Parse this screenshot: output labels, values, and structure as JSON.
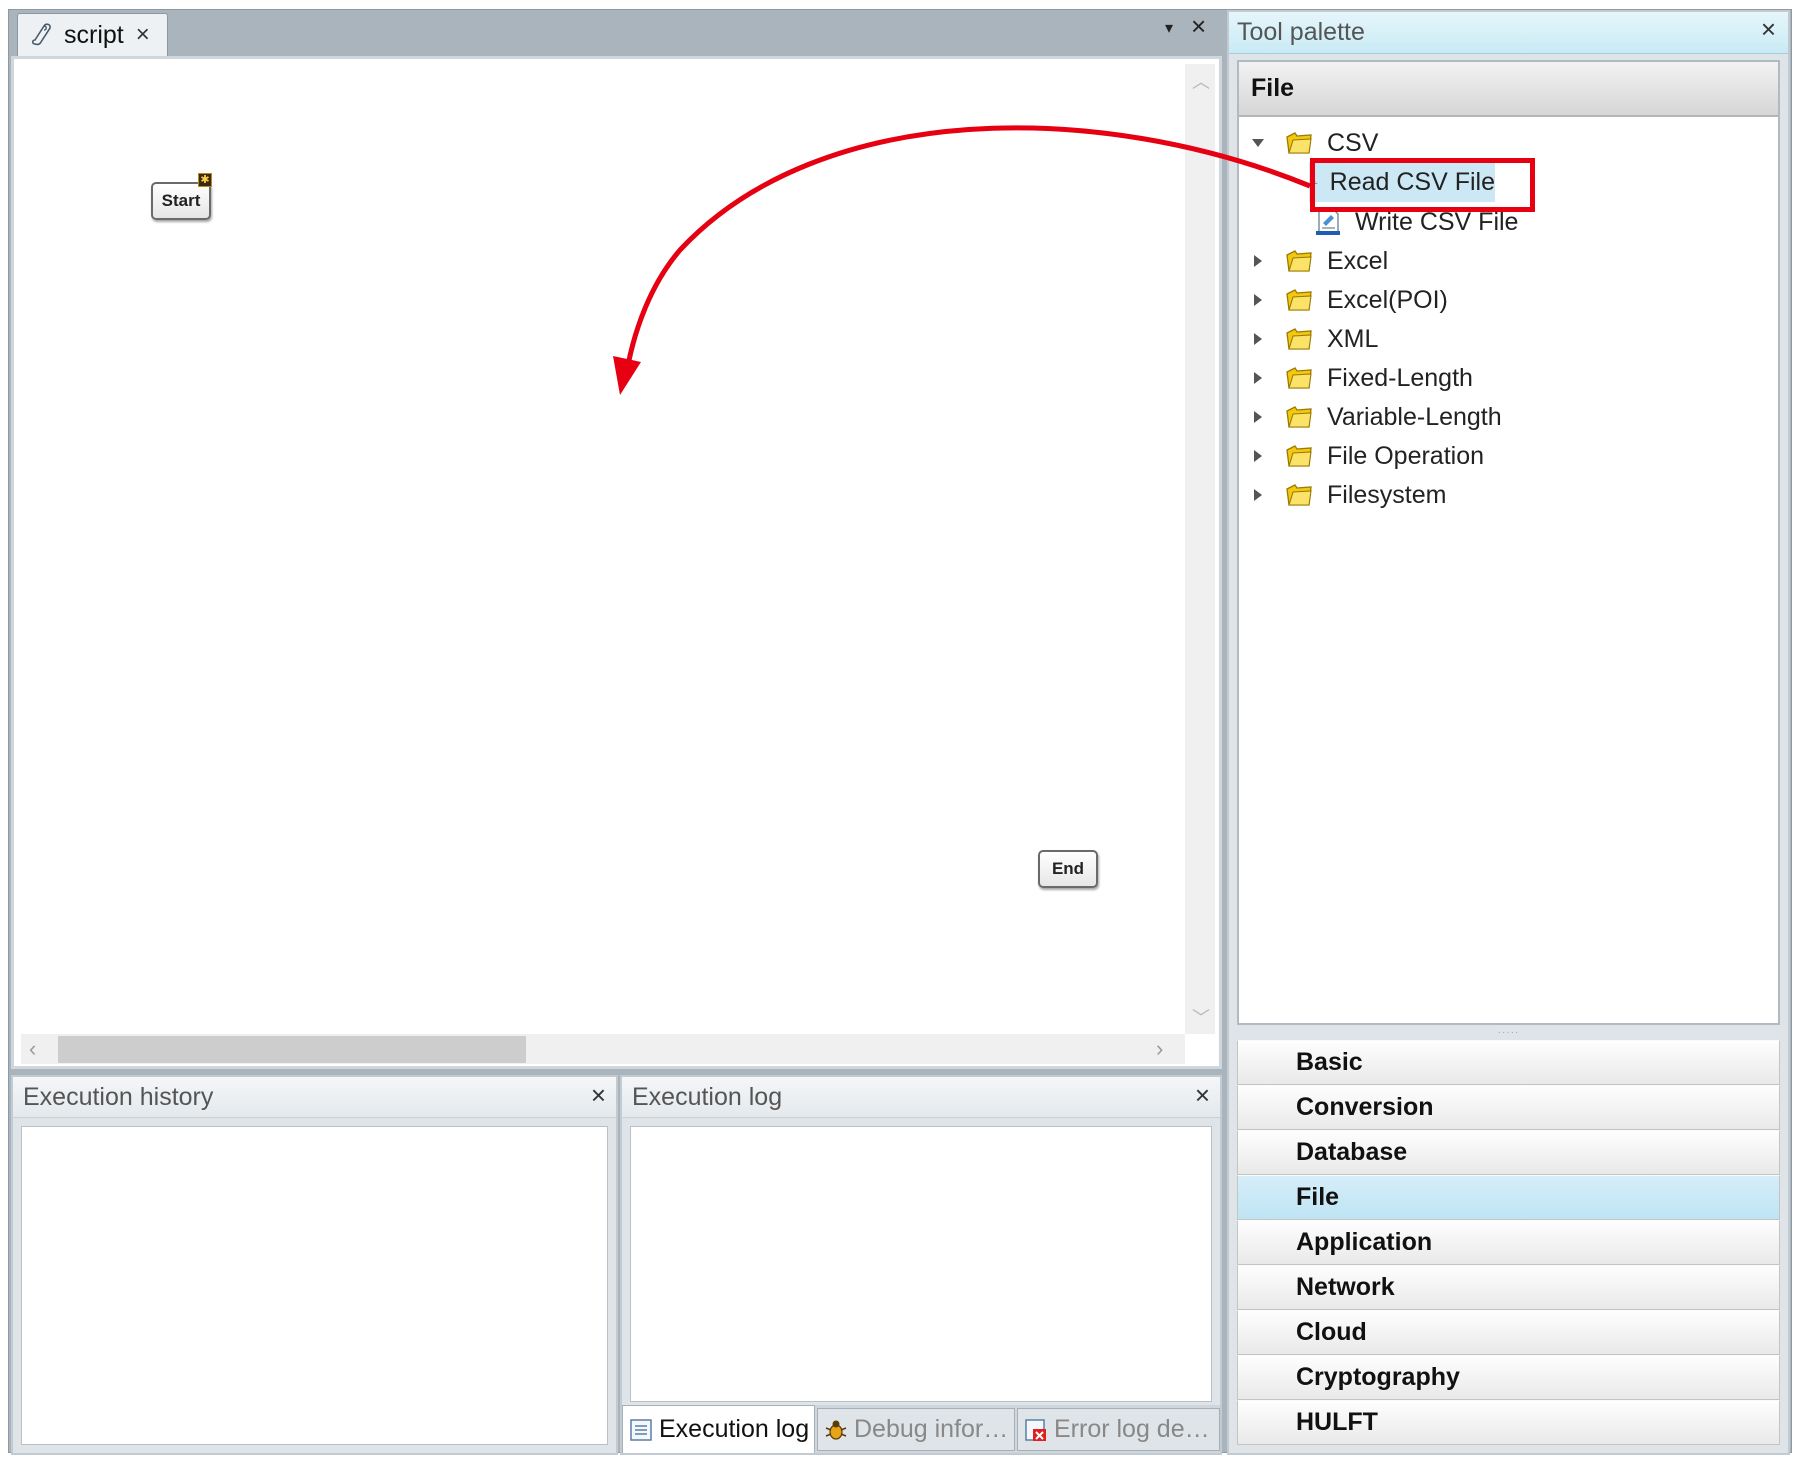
{
  "editor": {
    "tab_label": "script",
    "tab_close_glyph": "×",
    "menu_glyph": "▾",
    "close_all_glyph": "×",
    "nodes": {
      "start_label": "Start",
      "start_badge": "✱",
      "end_label": "End"
    },
    "scroll_up_glyph": "︿",
    "scroll_down_glyph": "﹀",
    "scroll_left_glyph": "‹",
    "scroll_right_glyph": "›"
  },
  "execution_history": {
    "title": "Execution history",
    "close_glyph": "×"
  },
  "execution_log": {
    "title": "Execution log",
    "close_glyph": "×",
    "tabs": [
      {
        "label": "Execution log",
        "icon": "log-icon"
      },
      {
        "label": "Debug infor…",
        "icon": "bug-icon"
      },
      {
        "label": "Error log de…",
        "icon": "error-log-icon"
      }
    ]
  },
  "palette": {
    "title": "Tool palette",
    "close_glyph": "×",
    "tree_title": "File",
    "tree": {
      "csv": {
        "label": "CSV",
        "icon": "folder-icon",
        "expanded": true
      },
      "read_csv": {
        "label": "Read CSV File",
        "icon": "csv-read-icon",
        "selected": true
      },
      "write_csv": {
        "label": "Write CSV File",
        "icon": "csv-write-icon"
      },
      "excel": {
        "label": "Excel",
        "icon": "folder-icon"
      },
      "excel_poi": {
        "label": "Excel(POI)",
        "icon": "folder-icon"
      },
      "xml": {
        "label": "XML",
        "icon": "folder-icon"
      },
      "fixed_length": {
        "label": "Fixed-Length",
        "icon": "folder-icon"
      },
      "variable_length": {
        "label": "Variable-Length",
        "icon": "folder-icon"
      },
      "file_operation": {
        "label": "File Operation",
        "icon": "folder-icon"
      },
      "filesystem": {
        "label": "Filesystem",
        "icon": "folder-icon"
      }
    },
    "splitter_glyph": "·····",
    "categories": {
      "basic": "Basic",
      "conversion": "Conversion",
      "database": "Database",
      "file": "File",
      "application": "Application",
      "network": "Network",
      "cloud": "Cloud",
      "cryptography": "Cryptography",
      "hulft": "HULFT"
    },
    "active_category": "File"
  },
  "colors": {
    "annotation_red": "#e60012",
    "selection_blue": "#cde8f5",
    "folder_yellow": "#f2c811",
    "palette_header": "#c9eaf5"
  }
}
